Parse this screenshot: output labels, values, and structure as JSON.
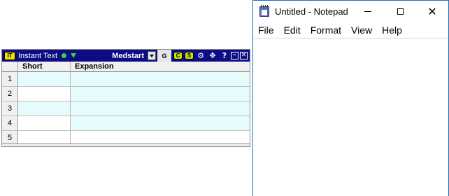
{
  "instant_text": {
    "logo": "IT",
    "title": "Instant Text",
    "profile": "Medstart",
    "g_label": "G",
    "c_label": "C",
    "s_label": "S",
    "icons": [
      "settings-gear-icon",
      "move-icon",
      "help-icon",
      "minimize-icon",
      "close-icon"
    ],
    "help_glyph": "?",
    "columns": [
      "Short",
      "Expansion"
    ],
    "rows": [
      "1",
      "2",
      "3",
      "4",
      "5"
    ],
    "colors": {
      "toolbar": "#0c0c84",
      "row_tint": "#e6fcfc",
      "logo": "#f2e200"
    }
  },
  "notepad": {
    "title": "Untitled - Notepad",
    "menu": [
      "File",
      "Edit",
      "Format",
      "View",
      "Help"
    ],
    "content": ""
  }
}
